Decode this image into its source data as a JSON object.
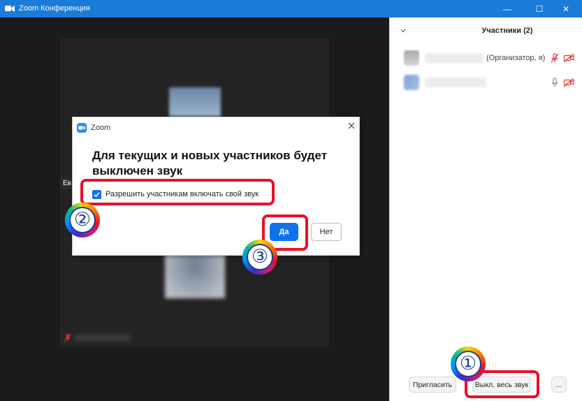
{
  "window": {
    "title": "Zoom Конференция",
    "controls": {
      "minimize": "—",
      "maximize": "☐",
      "close": "✕"
    }
  },
  "video": {
    "left_label": "Ев"
  },
  "participants_panel": {
    "collapse_icon": "chevron-down",
    "title": "Участники (2)",
    "rows": [
      {
        "role": "(Организатор, я)",
        "mic_state": "muted",
        "video_state": "off"
      },
      {
        "role": "",
        "mic_state": "on",
        "video_state": "off"
      }
    ],
    "invite_label": "Пригласить",
    "mute_all_label": "Выкл. весь звук",
    "more_label": "..."
  },
  "dialog": {
    "app_name": "Zoom",
    "heading": "Для текущих и новых участников будет выключен звук",
    "checkbox_label": "Разрешить участникам включать свой звук",
    "checkbox_checked": true,
    "yes_label": "Да",
    "no_label": "Нет"
  },
  "annotations": {
    "steps": [
      "①",
      "②",
      "③"
    ],
    "highlight_color": "#e8102b"
  },
  "colors": {
    "titlebar": "#1a7cd8",
    "primary_button": "#0e72ed",
    "video_bg": "#1b1b1b"
  }
}
